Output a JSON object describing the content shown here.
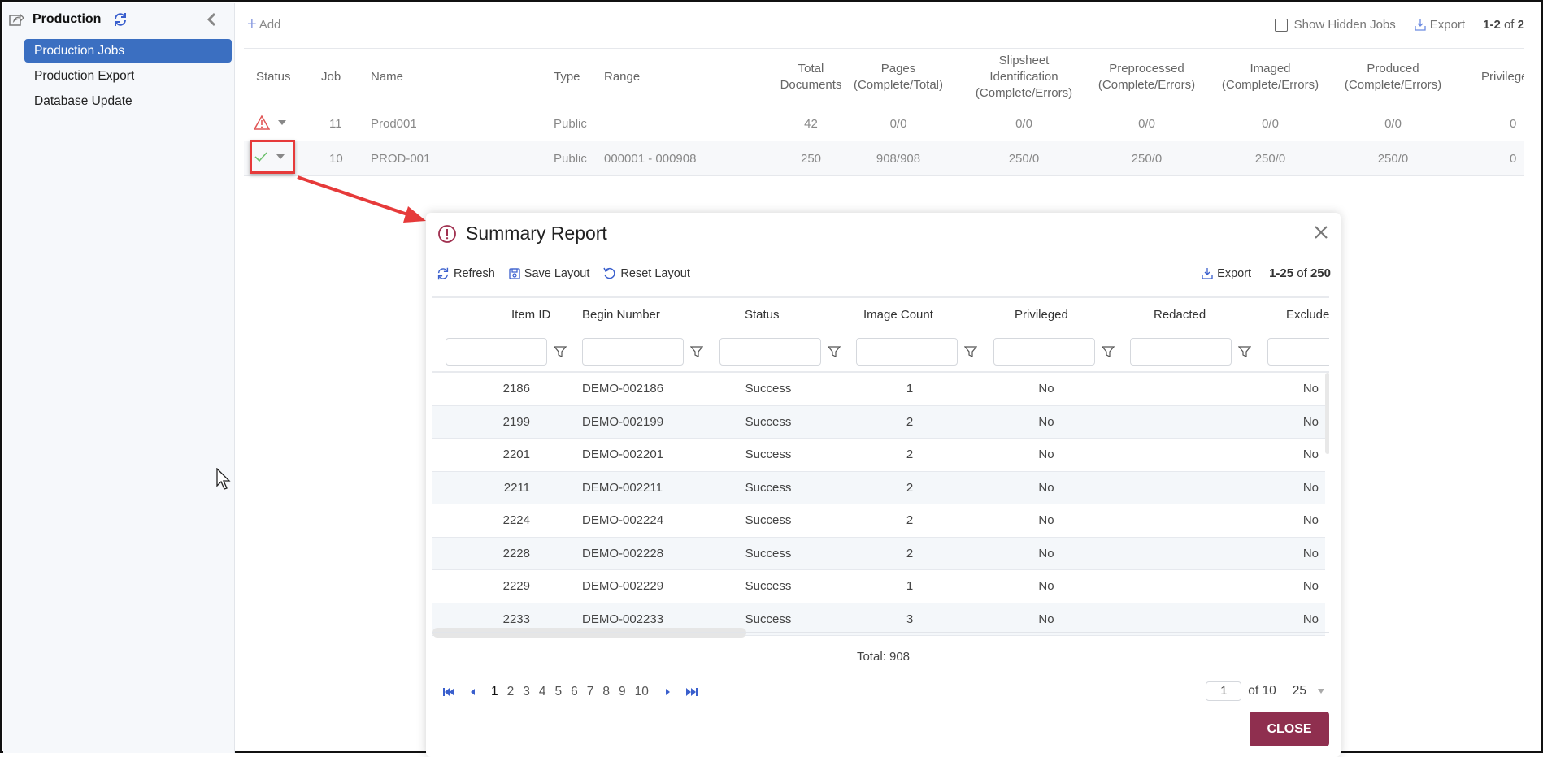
{
  "sidebar": {
    "title": "Production",
    "items": [
      {
        "label": "Production Jobs",
        "active": true
      },
      {
        "label": "Production Export",
        "active": false
      },
      {
        "label": "Database Update",
        "active": false
      }
    ]
  },
  "toolbar": {
    "add_label": "Add",
    "show_hidden_label": "Show Hidden Jobs",
    "export_label": "Export",
    "count_range": "1-2",
    "count_of": "of",
    "count_total": "2"
  },
  "jobs_table": {
    "columns": {
      "status": "Status",
      "job": "Job",
      "name": "Name",
      "type": "Type",
      "range": "Range",
      "total_docs": [
        "Total",
        "Documents"
      ],
      "pages": [
        "Pages",
        "(Complete/Total)"
      ],
      "slipsheet": [
        "Slipsheet",
        "Identification",
        "(Complete/Errors)"
      ],
      "preprocessed": [
        "Preprocessed",
        "(Complete/Errors)"
      ],
      "imaged": [
        "Imaged",
        "(Complete/Errors)"
      ],
      "produced": [
        "Produced",
        "(Complete/Errors)"
      ],
      "privileged": "Privileged"
    },
    "rows": [
      {
        "status": "warning",
        "job": "11",
        "name": "Prod001",
        "type": "Public",
        "range": "",
        "total_docs": "42",
        "pages": "0/0",
        "slipsheet": "0/0",
        "preprocessed": "0/0",
        "imaged": "0/0",
        "produced": "0/0",
        "privileged": "0"
      },
      {
        "status": "success",
        "job": "10",
        "name": "PROD-001",
        "type": "Public",
        "range": "000001 - 000908",
        "total_docs": "250",
        "pages": "908/908",
        "slipsheet": "250/0",
        "preprocessed": "250/0",
        "imaged": "250/0",
        "produced": "250/0",
        "privileged": "0"
      }
    ]
  },
  "modal": {
    "title": "Summary Report",
    "tools": {
      "refresh": "Refresh",
      "save_layout": "Save Layout",
      "reset_layout": "Reset Layout",
      "export": "Export"
    },
    "count_range": "1-25",
    "count_of": "of",
    "count_total": "250",
    "columns": [
      "Item ID",
      "Begin Number",
      "Status",
      "Image Count",
      "Privileged",
      "Redacted",
      "Excluded"
    ],
    "rows": [
      {
        "item_id": "2186",
        "begin": "DEMO-002186",
        "status": "Success",
        "image_count": "1",
        "privileged": "No",
        "redacted": "",
        "excluded": "No"
      },
      {
        "item_id": "2199",
        "begin": "DEMO-002199",
        "status": "Success",
        "image_count": "2",
        "privileged": "No",
        "redacted": "",
        "excluded": "No"
      },
      {
        "item_id": "2201",
        "begin": "DEMO-002201",
        "status": "Success",
        "image_count": "2",
        "privileged": "No",
        "redacted": "",
        "excluded": "No"
      },
      {
        "item_id": "2211",
        "begin": "DEMO-002211",
        "status": "Success",
        "image_count": "2",
        "privileged": "No",
        "redacted": "",
        "excluded": "No"
      },
      {
        "item_id": "2224",
        "begin": "DEMO-002224",
        "status": "Success",
        "image_count": "2",
        "privileged": "No",
        "redacted": "",
        "excluded": "No"
      },
      {
        "item_id": "2228",
        "begin": "DEMO-002228",
        "status": "Success",
        "image_count": "2",
        "privileged": "No",
        "redacted": "",
        "excluded": "No"
      },
      {
        "item_id": "2229",
        "begin": "DEMO-002229",
        "status": "Success",
        "image_count": "1",
        "privileged": "No",
        "redacted": "",
        "excluded": "No"
      },
      {
        "item_id": "2233",
        "begin": "DEMO-002233",
        "status": "Success",
        "image_count": "3",
        "privileged": "No",
        "redacted": "",
        "excluded": "No"
      }
    ],
    "total_label": "Total: 908",
    "pages": [
      "1",
      "2",
      "3",
      "4",
      "5",
      "6",
      "7",
      "8",
      "9",
      "10"
    ],
    "current_page": "1",
    "page_of": "of 10",
    "page_size": "25",
    "close_label": "CLOSE"
  },
  "colors": {
    "accent": "#3b6fc1",
    "close_button": "#8f2f4f",
    "success": "#5cb85c",
    "warning": "#e05555",
    "annotation": "#e63a3a"
  }
}
